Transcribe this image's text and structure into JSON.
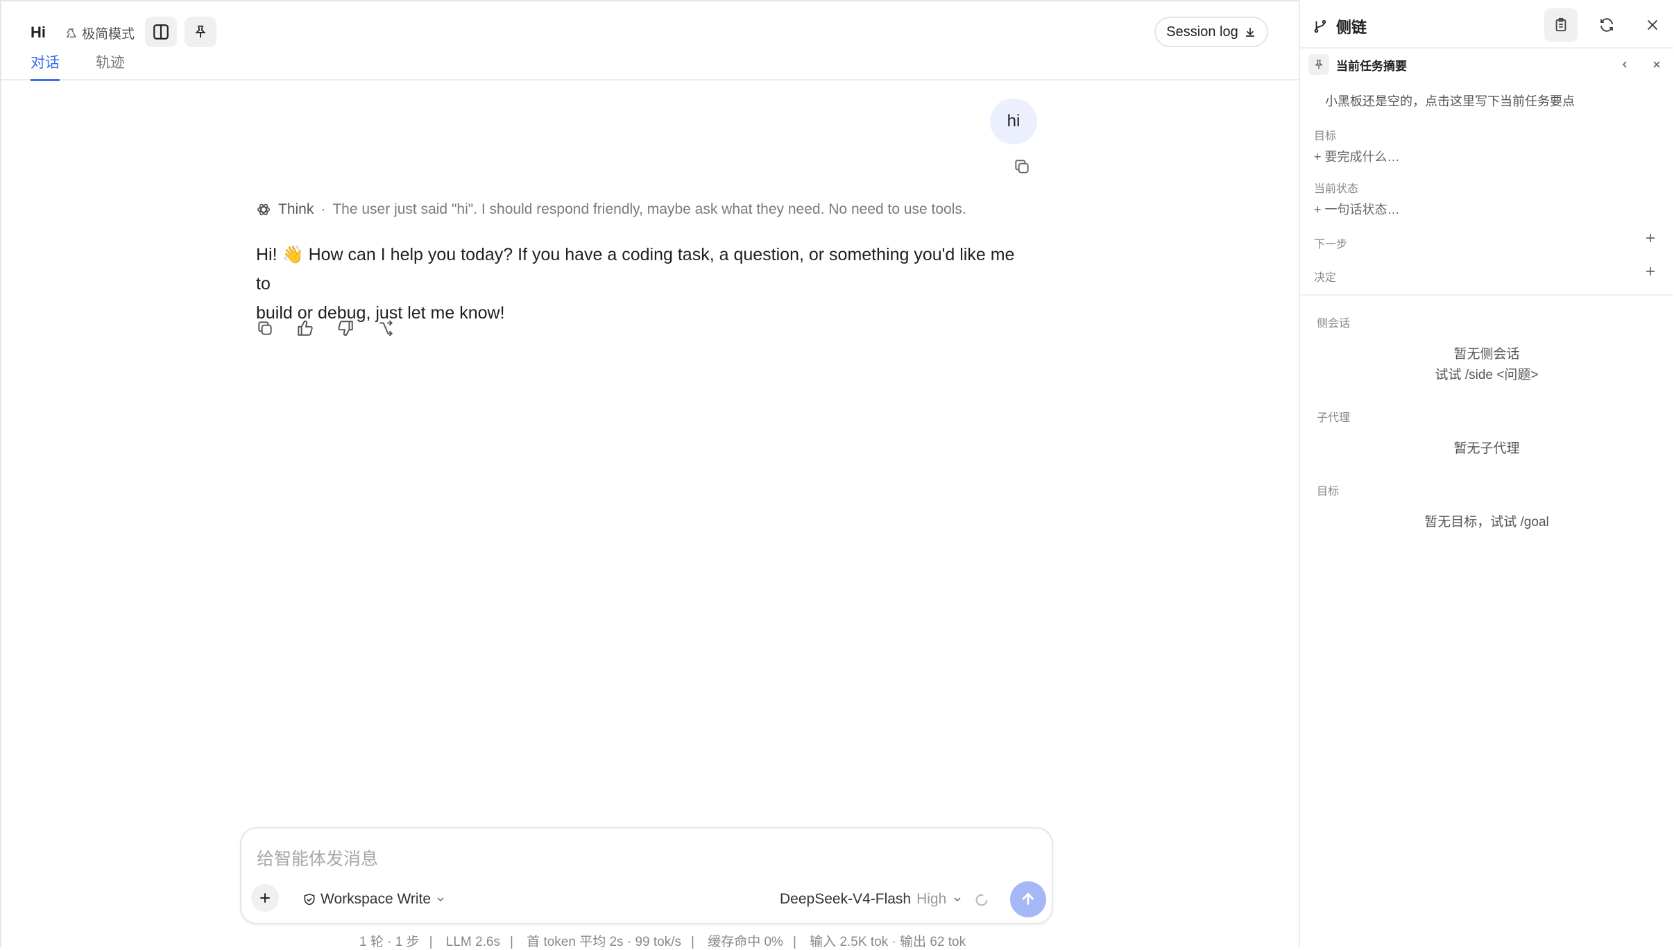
{
  "header": {
    "title": "Hi",
    "mode_label": "极简模式",
    "session_log": "Session log",
    "tabs": [
      {
        "label": "对话",
        "active": true
      },
      {
        "label": "轨迹",
        "active": false
      }
    ]
  },
  "conversation": {
    "user_message": "hi",
    "think_label": "Think",
    "think_text": "The user just said \"hi\". I should respond friendly, maybe ask what they need. No need to use tools.",
    "answer_line1": "Hi! 👋 How can I help you today? If you have a coding task, a question, or something you'd like me to",
    "answer_line2": "build or debug, just let me know!"
  },
  "composer": {
    "placeholder": "给智能体发消息",
    "permission": "Workspace Write",
    "model": "DeepSeek-V4-Flash",
    "effort": "High"
  },
  "stats": {
    "turns": "1 轮 · 1 步",
    "llm": "LLM 2.6s",
    "first_token": "首 token 平均 2s · 99 tok/s",
    "cache": "缓存命中 0%",
    "io": "输入 2.5K tok · 输出 62 tok"
  },
  "side": {
    "title": "侧链",
    "summary_title": "当前任务摘要",
    "summary_hint": "小黑板还是空的，点击这里写下当前任务要点",
    "goal_label": "目标",
    "goal_add": "+ 要完成什么…",
    "state_label": "当前状态",
    "state_add": "+ 一句话状态…",
    "next_label": "下一步",
    "decision_label": "决定",
    "side_session_label": "侧会话",
    "side_session_empty": "暂无侧会话",
    "side_session_hint": "试试 /side <问题>",
    "subagent_label": "子代理",
    "subagent_empty": "暂无子代理",
    "goals_label": "目标",
    "goals_empty": "暂无目标，试试 /goal"
  }
}
